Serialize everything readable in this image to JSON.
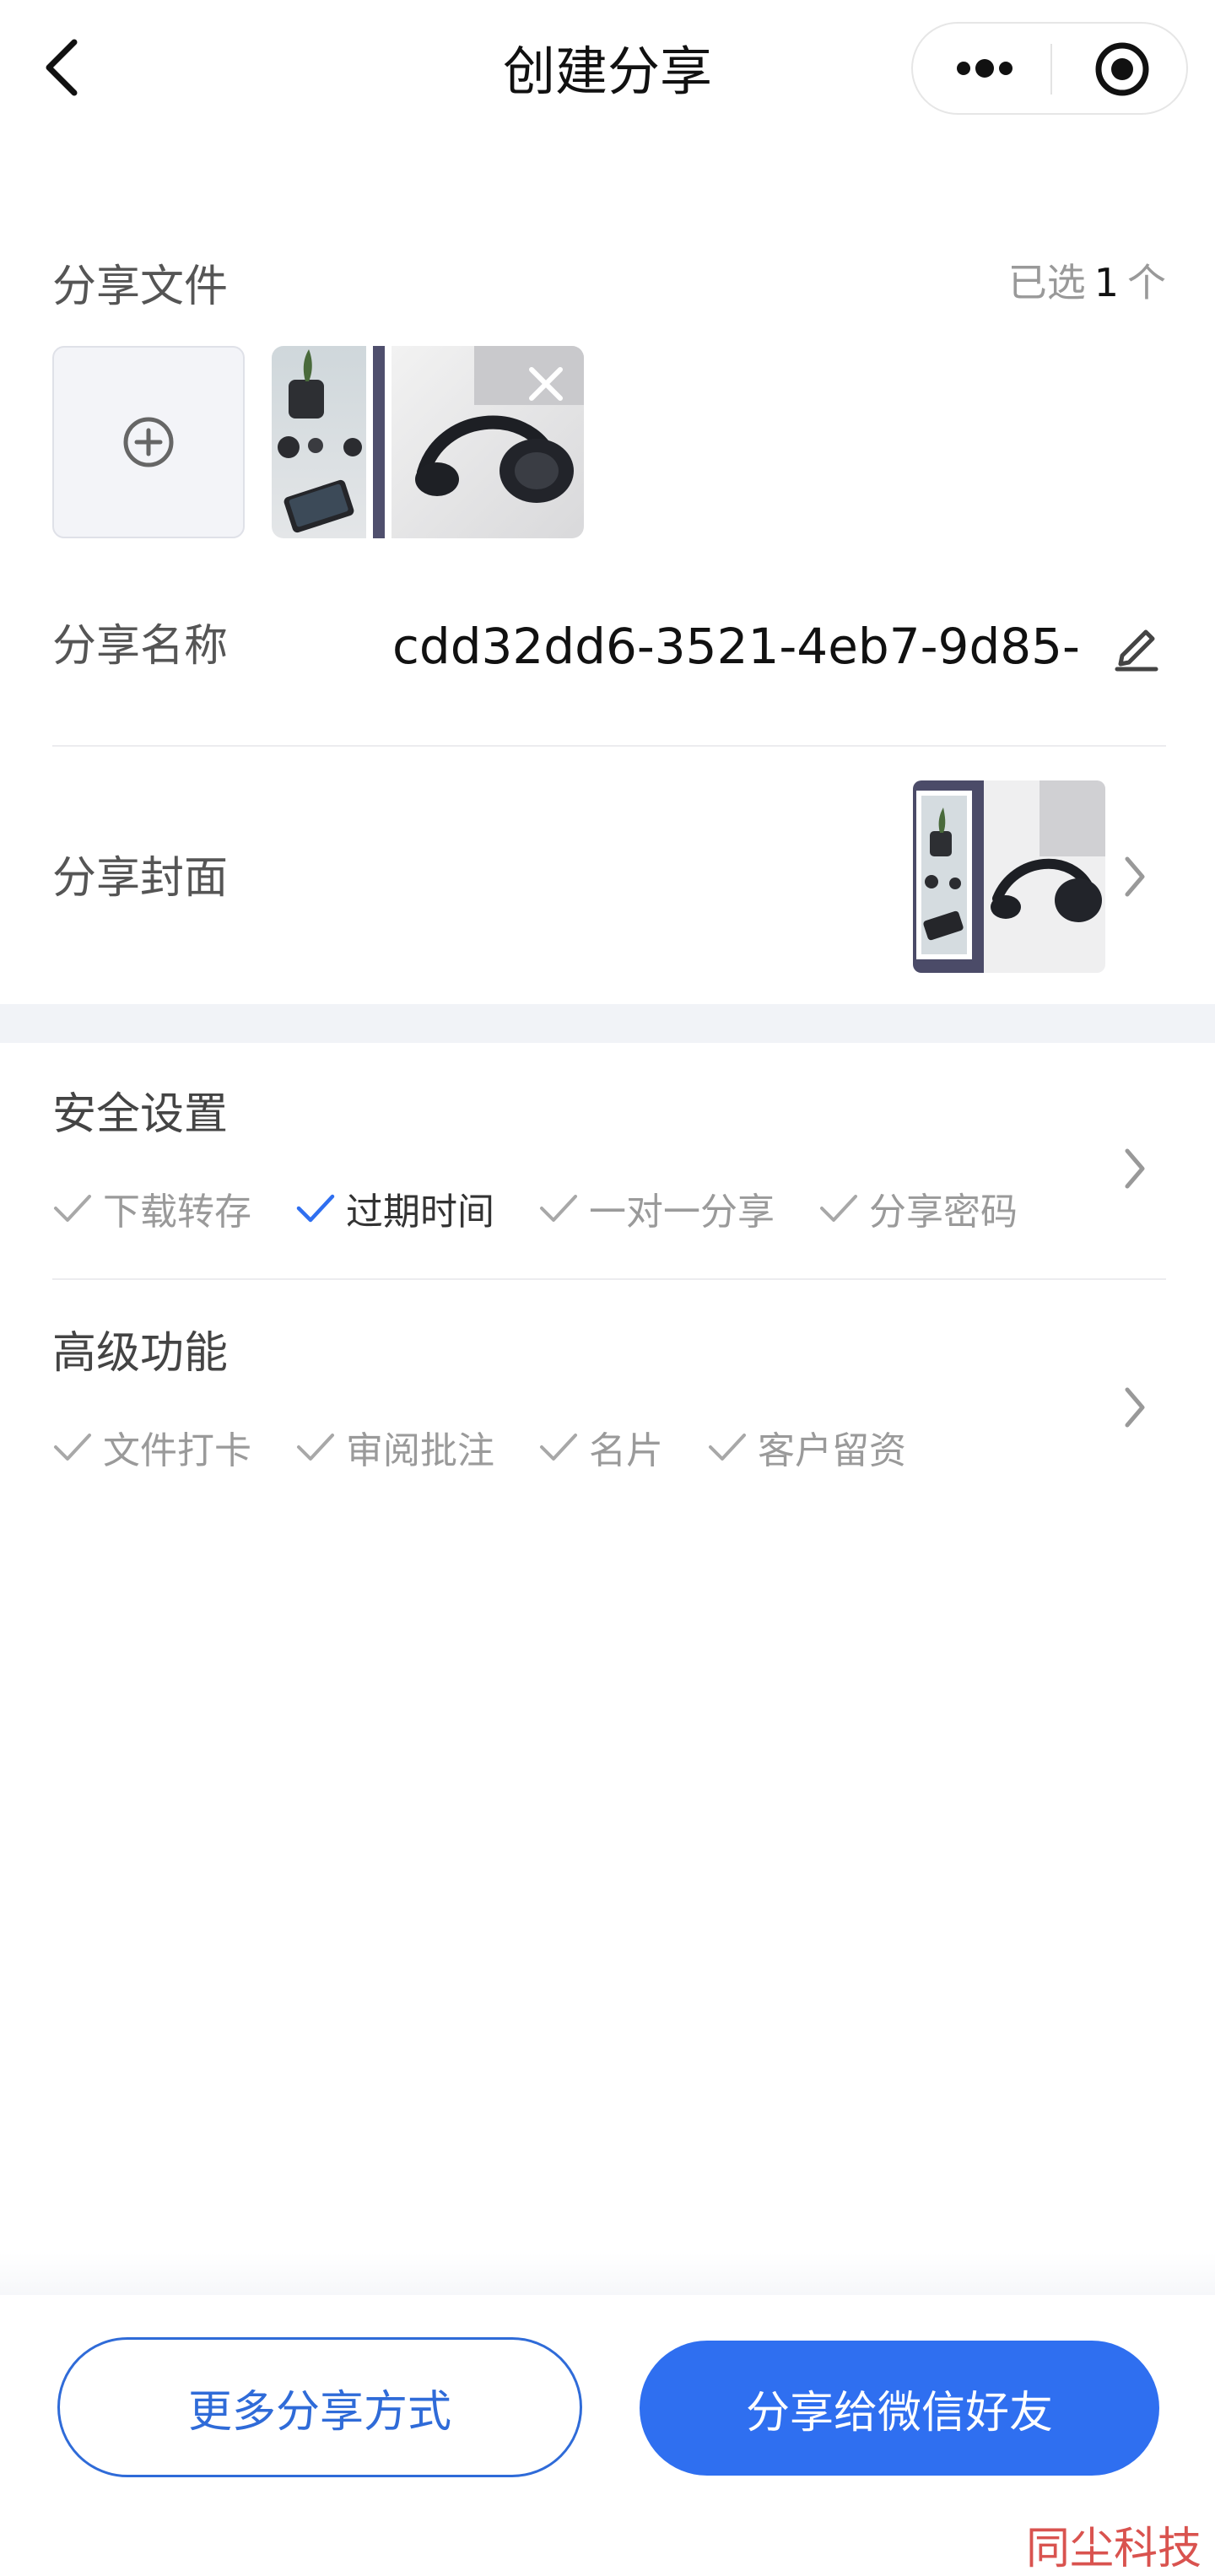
{
  "nav": {
    "title": "创建分享"
  },
  "files": {
    "label": "分享文件",
    "selected_prefix": "已选",
    "selected_count": "1",
    "selected_suffix": "个"
  },
  "share_name": {
    "label": "分享名称",
    "value": "cdd32dd6-3521-4eb7-9d85-"
  },
  "cover": {
    "label": "分享封面"
  },
  "security": {
    "title": "安全设置",
    "tags": [
      {
        "label": "下载转存",
        "checked": false
      },
      {
        "label": "过期时间",
        "checked": true
      },
      {
        "label": "一对一分享",
        "checked": false
      },
      {
        "label": "分享密码",
        "checked": false
      }
    ]
  },
  "advanced": {
    "title": "高级功能",
    "tags": [
      {
        "label": "文件打卡",
        "checked": false
      },
      {
        "label": "审阅批注",
        "checked": false
      },
      {
        "label": "名片",
        "checked": false
      },
      {
        "label": "客户留资",
        "checked": false
      }
    ]
  },
  "buttons": {
    "more": "更多分享方式",
    "wechat": "分享给微信好友"
  },
  "colors": {
    "accent": "#2f6ff0",
    "accent_outline": "#2f6bd8",
    "watermark": "#d9534f"
  },
  "icons": [
    "back-arrow-icon",
    "more-dots-icon",
    "target-icon",
    "add-circle-icon",
    "close-icon",
    "edit-pencil-icon",
    "chevron-right-icon",
    "check-icon"
  ],
  "watermark": "同尘科技"
}
